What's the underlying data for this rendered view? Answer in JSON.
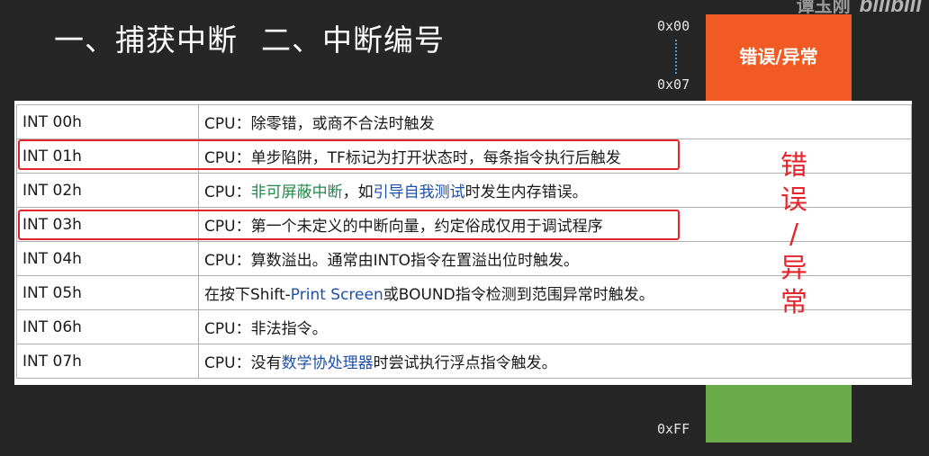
{
  "title": {
    "part1": "一、捕获中断",
    "part2": "二、中断编号"
  },
  "watermark": {
    "author": "谭玉刚",
    "logo": "bilibili"
  },
  "address_map": {
    "start": "0x00",
    "first_end": "0x07",
    "end": "0xFF",
    "orange_label": "错误/异常",
    "colors": {
      "orange": "#f15a22",
      "green": "#6aab4a"
    }
  },
  "side_note": {
    "chars": [
      "错",
      "误",
      "/",
      "异",
      "常"
    ]
  },
  "table": {
    "rows": [
      {
        "code": "INT 00h",
        "segments": [
          {
            "t": "CPU：除零错，或商不合法时触发",
            "c": ""
          }
        ]
      },
      {
        "code": "INT 01h",
        "segments": [
          {
            "t": "CPU：单步陷阱，TF标记为打开状态时，每条指令执行后触发",
            "c": ""
          }
        ]
      },
      {
        "code": "INT 02h",
        "segments": [
          {
            "t": "CPU：",
            "c": ""
          },
          {
            "t": "非可屏蔽中断",
            "c": "green"
          },
          {
            "t": "，如",
            "c": ""
          },
          {
            "t": "引导自我测试",
            "c": "blue"
          },
          {
            "t": "时发生内存错误。",
            "c": ""
          }
        ]
      },
      {
        "code": "INT 03h",
        "segments": [
          {
            "t": "CPU：第一个未定义的中断向量，约定俗成仅用于调试程序",
            "c": ""
          }
        ]
      },
      {
        "code": "INT 04h",
        "segments": [
          {
            "t": "CPU：算数溢出。通常由INTO指令在置溢出位时触发。",
            "c": ""
          }
        ]
      },
      {
        "code": "INT 05h",
        "segments": [
          {
            "t": "在按下Shift-",
            "c": ""
          },
          {
            "t": "Print Screen",
            "c": "blue"
          },
          {
            "t": "或BOUND指令检测到范围异常时触发。",
            "c": ""
          }
        ]
      },
      {
        "code": "INT 06h",
        "segments": [
          {
            "t": "CPU：非法指令。",
            "c": ""
          }
        ]
      },
      {
        "code": "INT 07h",
        "segments": [
          {
            "t": "CPU：没有",
            "c": ""
          },
          {
            "t": "数学协处理器",
            "c": "blue"
          },
          {
            "t": "时尝试执行浮点指令触发。",
            "c": ""
          }
        ]
      }
    ]
  }
}
